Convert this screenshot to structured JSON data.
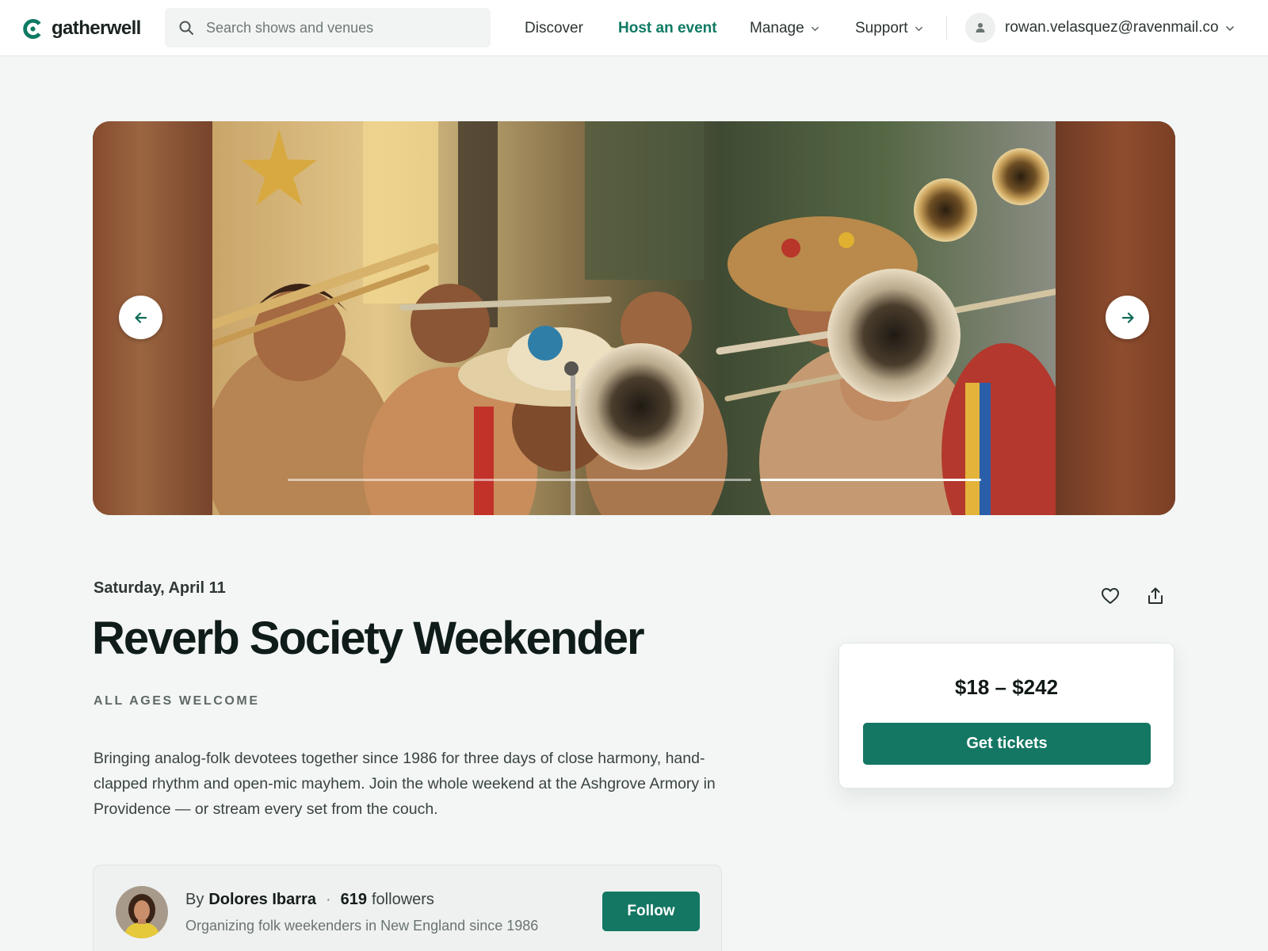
{
  "header": {
    "logo_text": "gatherwell",
    "search_placeholder": "Search shows and venues",
    "nav": {
      "discover": "Discover",
      "host": "Host an event",
      "manage": "Manage",
      "support": "Support"
    },
    "user_email": "rowan.velasquez@ravenmail.co",
    "accent_color": "#0f7a63"
  },
  "hero": {
    "slide_count": 2,
    "active_slide": 2
  },
  "event": {
    "date": "Saturday, April 11",
    "title": "Reverb Society Weekender",
    "age_tag": "ALL AGES WELCOME",
    "description": "Bringing analog-folk devotees together since 1986 for three days of close harmony, hand-clapped rhythm and open-mic mayhem. Join the whole weekend at the Ashgrove Armory in Providence — or stream every set from the couch."
  },
  "ticket": {
    "price_range": "$18 – $242",
    "button_label": "Get tickets",
    "button_color": "#137763"
  },
  "organizer": {
    "by_label": "By",
    "name": "Dolores Ibarra",
    "followers_count": "619",
    "followers_label": "followers",
    "tagline": "Organizing folk weekenders in New England since 1986",
    "follow_label": "Follow"
  }
}
